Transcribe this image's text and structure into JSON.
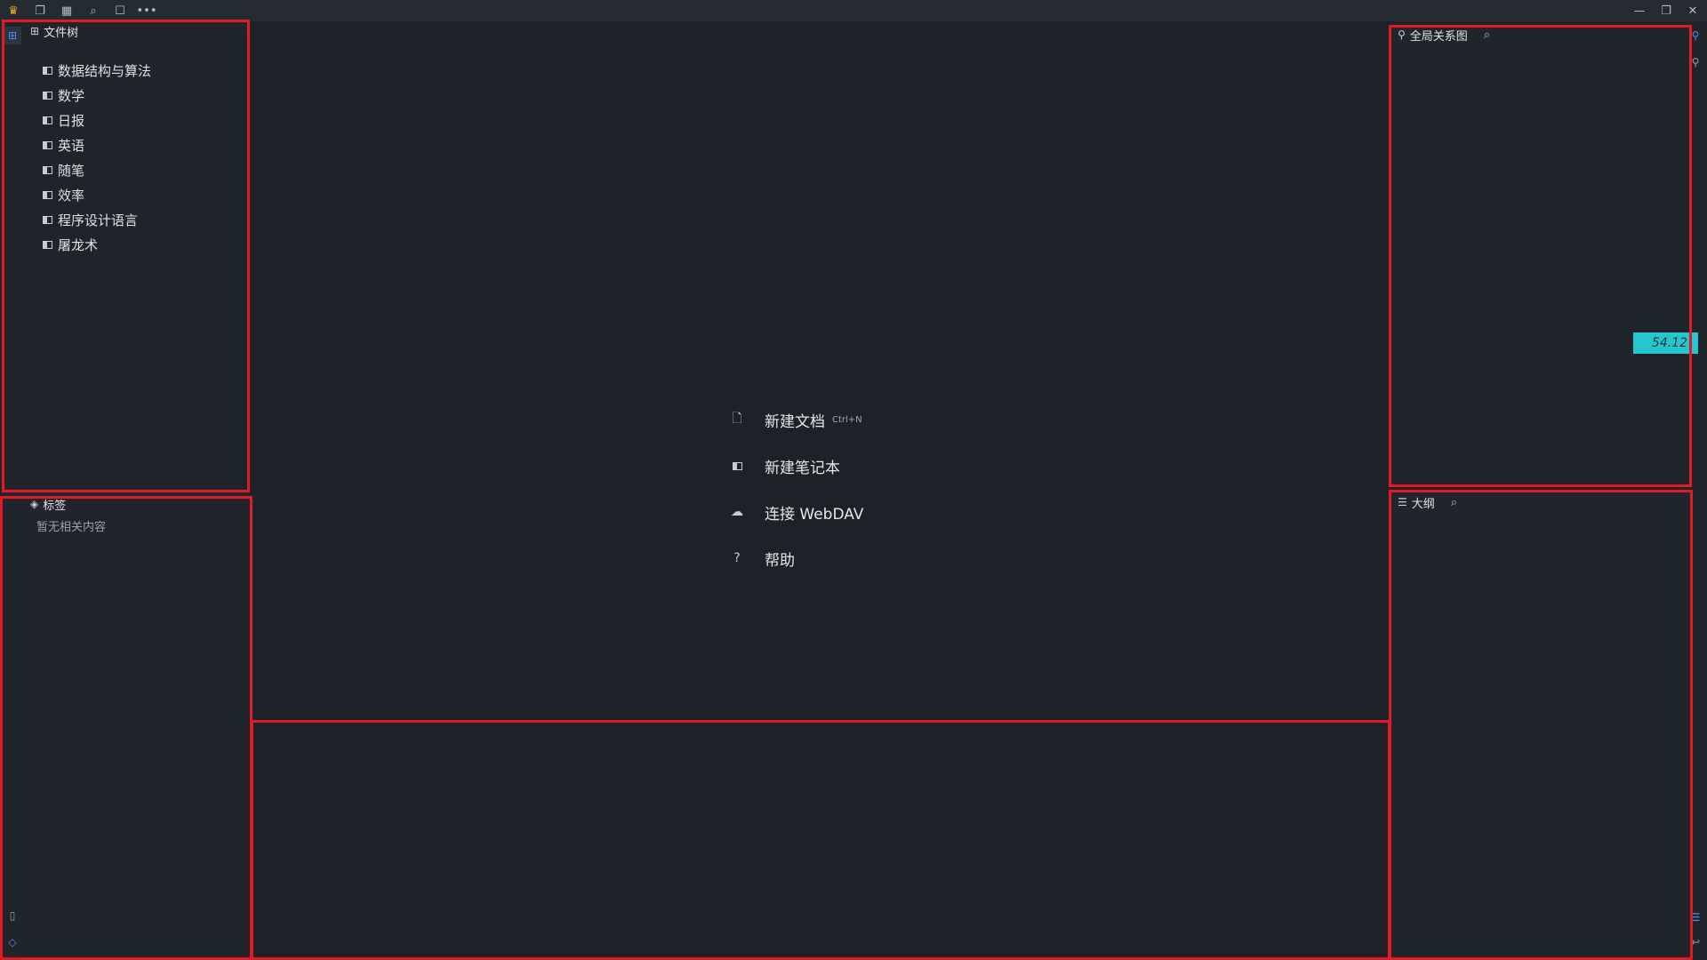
{
  "topbar": {
    "icons": [
      "crown-icon",
      "copy-icon",
      "calendar-icon",
      "search-icon",
      "layout-icon",
      "more-icon"
    ],
    "window_controls": [
      "minimize-icon",
      "restore-icon",
      "close-icon"
    ]
  },
  "file_tree": {
    "title": "文件树",
    "items": [
      {
        "label": "数据结构与算法"
      },
      {
        "label": "数学"
      },
      {
        "label": "日报"
      },
      {
        "label": "英语"
      },
      {
        "label": "随笔"
      },
      {
        "label": "效率"
      },
      {
        "label": "程序设计语言"
      },
      {
        "label": "屠龙术"
      }
    ]
  },
  "tags": {
    "title": "标签",
    "empty": "暂无相关内容"
  },
  "graph": {
    "title": "全局关系图"
  },
  "outline": {
    "title": "大纲"
  },
  "center": {
    "new_doc": "新建文档",
    "new_doc_shortcut": "Ctrl+N",
    "new_notebook": "新建笔记本",
    "connect": "连接 WebDAV",
    "help": "帮助"
  },
  "badge": "54.12",
  "colors": {
    "background": "#1e2127",
    "panel": "#1f232a",
    "highlight_box": "#e11a25",
    "badge": "#27c6cf"
  }
}
